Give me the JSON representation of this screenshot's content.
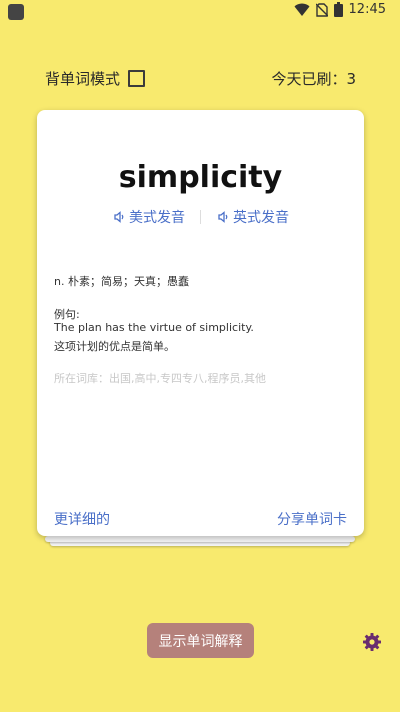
{
  "status": {
    "time": "12:45"
  },
  "header": {
    "mode_label": "背单词模式",
    "count_label": "今天已刷：3"
  },
  "card": {
    "word": "simplicity",
    "us_pron": "美式发音",
    "uk_pron": "英式发音",
    "meaning": "n. 朴素；简易；天真；愚蠢",
    "example_label": "例句:",
    "example_en": "The plan has the virtue of simplicity.",
    "example_zh": "这项计划的优点是简单。",
    "library": "所在词库：出国,高中,专四专八,程序员,其他",
    "detail_link": "更详细的",
    "share_link": "分享单词卡"
  },
  "footer": {
    "show_button": "显示单词解释"
  },
  "colors": {
    "background": "#f8ea6e",
    "accent_blue": "#4a6fc8",
    "button": "#b5817b",
    "gear": "#6a2c6f"
  },
  "icons": [
    "app-icon",
    "wifi-icon",
    "no-sim-icon",
    "battery-icon",
    "speaker-icon",
    "gear-icon"
  ]
}
